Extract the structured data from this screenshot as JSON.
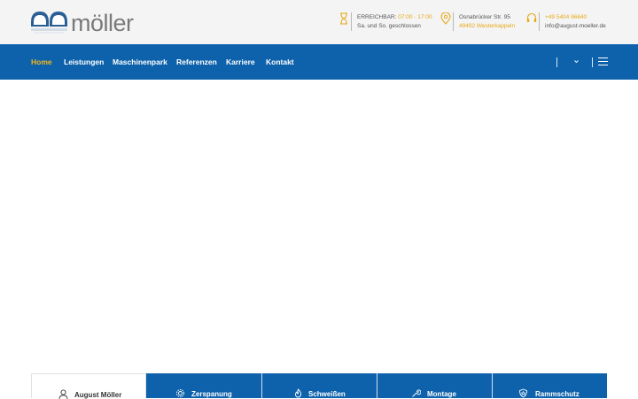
{
  "header": {
    "logo": {
      "text": "möller",
      "icon": "moeller-logo-icon"
    },
    "hours": {
      "icon": "hourglass-icon",
      "label": "ERREICHBAR:",
      "time": "07:00 - 17:00",
      "note": "Sa. und So. geschlossen"
    },
    "address": {
      "icon": "location-pin-icon",
      "street": "Osnabrücker Str. 95",
      "city": "49492 Westerkappeln"
    },
    "contact": {
      "icon": "headset-icon",
      "phone": "+49 5404 96640",
      "email": "info@august-moeller.de"
    }
  },
  "nav": {
    "items": [
      {
        "label": "Home",
        "active": true
      },
      {
        "label": "Leistungen",
        "active": false
      },
      {
        "label": "Maschinenpark",
        "active": false
      },
      {
        "label": "Referenzen",
        "active": false
      },
      {
        "label": "Karriere",
        "active": false
      },
      {
        "label": "Kontakt",
        "active": false
      }
    ],
    "language_dropdown_icon": "chevron-down-icon",
    "menu_icon": "hamburger-menu-icon"
  },
  "tabs": [
    {
      "label": "August Möller",
      "icon": "user-icon"
    },
    {
      "label": "Zerspanung",
      "icon": "gear-icon"
    },
    {
      "label": "Schweißen",
      "icon": "flame-icon"
    },
    {
      "label": "Montage",
      "icon": "wrench-icon"
    },
    {
      "label": "Rammschutz",
      "icon": "shield-icon"
    }
  ],
  "colors": {
    "primary": "#0e62ab",
    "accent": "#f1b71a",
    "topbar": "#f4f4f4"
  }
}
